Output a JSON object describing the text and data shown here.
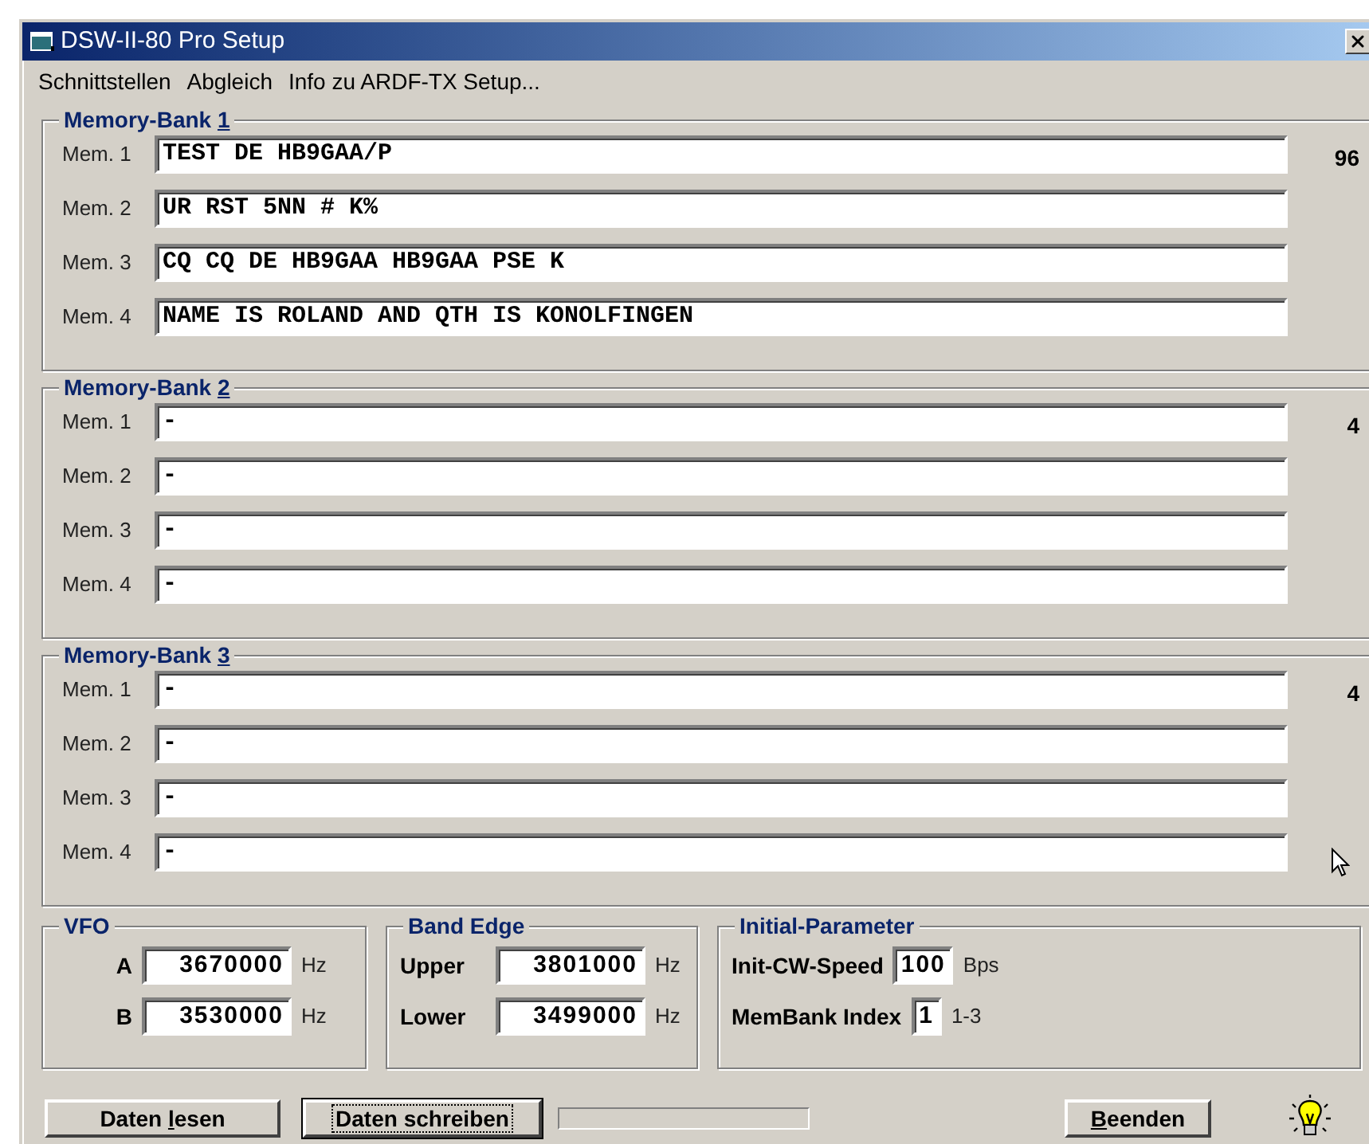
{
  "window": {
    "title": "DSW-II-80 Pro Setup"
  },
  "menu": [
    "Schnittstellen",
    "Abgleich",
    "Info zu ARDF-TX Setup..."
  ],
  "banks": [
    {
      "title": "Memory-Bank ",
      "hotkey": "1",
      "count": "96",
      "memories": [
        {
          "label": "Mem. 1",
          "value": "TEST DE HB9GAA/P"
        },
        {
          "label": "Mem. 2",
          "value": "UR RST 5NN # K%"
        },
        {
          "label": "Mem. 3",
          "value": "CQ CQ DE HB9GAA HB9GAA PSE K"
        },
        {
          "label": "Mem. 4",
          "value": "NAME IS ROLAND AND QTH IS KONOLFINGEN"
        }
      ]
    },
    {
      "title": "Memory-Bank ",
      "hotkey": "2",
      "count": "4",
      "memories": [
        {
          "label": "Mem. 1",
          "value": "-"
        },
        {
          "label": "Mem. 2",
          "value": "-"
        },
        {
          "label": "Mem. 3",
          "value": "-"
        },
        {
          "label": "Mem. 4",
          "value": "-"
        }
      ]
    },
    {
      "title": "Memory-Bank ",
      "hotkey": "3",
      "count": "4",
      "memories": [
        {
          "label": "Mem. 1",
          "value": "-"
        },
        {
          "label": "Mem. 2",
          "value": "-"
        },
        {
          "label": "Mem. 3",
          "value": "-"
        },
        {
          "label": "Mem. 4",
          "value": "-"
        }
      ]
    }
  ],
  "vfo": {
    "title": "VFO",
    "rows": [
      {
        "label": "A",
        "value": "3670000",
        "unit": "Hz"
      },
      {
        "label": "B",
        "value": "3530000",
        "unit": "Hz"
      }
    ]
  },
  "band_edge": {
    "title": "Band Edge",
    "rows": [
      {
        "label": "Upper",
        "value": "3801000",
        "unit": "Hz"
      },
      {
        "label": "Lower",
        "value": "3499000",
        "unit": "Hz"
      }
    ]
  },
  "initial": {
    "title": "Initial-Parameter",
    "rows": [
      {
        "label": "Init-CW-Speed",
        "value": "100",
        "unit": "Bps"
      },
      {
        "label": "MemBank Index",
        "value": "1",
        "unit": "1-3"
      }
    ]
  },
  "buttons": [
    {
      "before": "Daten ",
      "hotkey": "l",
      "after": "esen",
      "focused": false
    },
    {
      "before": "Daten schreiben",
      "focused": true
    }
  ],
  "exit_button": {
    "hotkey": "B",
    "after": "eenden",
    "focused": false
  }
}
